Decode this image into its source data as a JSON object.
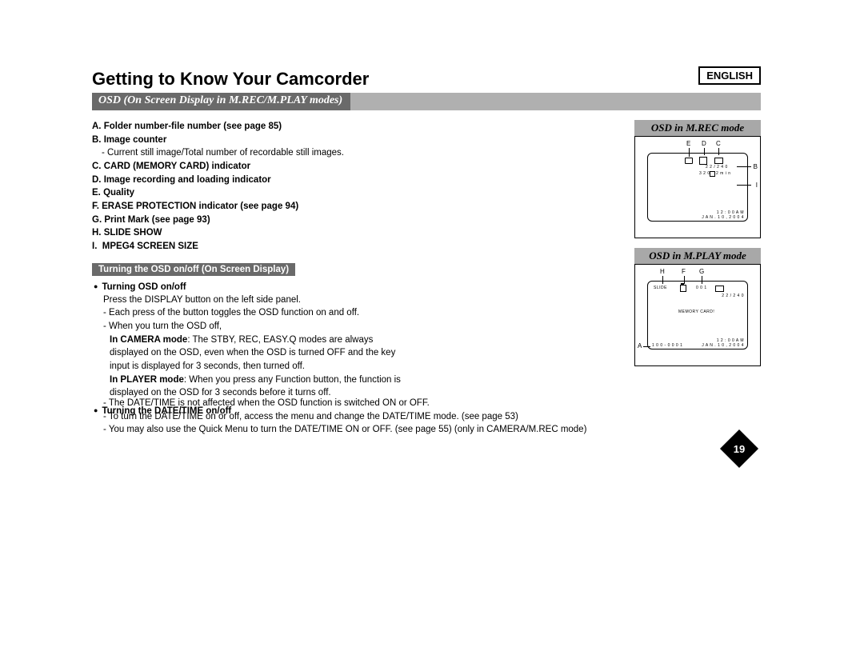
{
  "language_label": "ENGLISH",
  "page_title": "Getting to Know Your Camcorder",
  "banner": "OSD (On Screen Display in M.REC/M.PLAY modes)",
  "indicators": {
    "A": "Folder number-file number (see page 85)",
    "B": "Image counter",
    "B_sub": "Current still image/Total number of recordable still images.",
    "C": "CARD (MEMORY CARD) indicator",
    "D": "Image recording and loading indicator",
    "E": "Quality",
    "F": "ERASE PROTECTION indicator (see page 94)",
    "G": "Print Mark (see page 93)",
    "H": "SLIDE SHOW",
    "I": "MPEG4 SCREEN SIZE"
  },
  "section_bar": "Turning the OSD on/off (On Screen Display)",
  "bullet1_title": "Turning OSD on/off",
  "bullet1_body": "Press the DISPLAY button on the left side panel.",
  "bullet1_d1": "Each press of the button toggles the OSD function on and off.",
  "bullet1_d2": "When you turn the OSD off,",
  "bullet1_cam_lead": "In CAMERA mode",
  "bullet1_cam_text": ": The STBY, REC, EASY.Q modes are always displayed on the OSD, even when the OSD is turned OFF and the key input is displayed for 3 seconds, then turned off.",
  "bullet1_play_lead": "In PLAYER mode",
  "bullet1_play_text": ": When you press any Function button, the function is displayed on the OSD for 3 seconds before it turns off.",
  "bullet2_title": "Turning the DATE/TIME on/off",
  "bullet2_d1": "The DATE/TIME is not affected when the OSD function is switched ON or OFF.",
  "bullet2_d2": "To turn the DATE/TIME on or off, access the menu and change the DATE/TIME mode. (see page 53)",
  "bullet2_d3": "You may also use the Quick Menu to turn the DATE/TIME ON or OFF. (see page 55) (only in CAMERA/M.REC mode)",
  "diagram1_title": "OSD in M.REC mode",
  "diagram1": {
    "labels": {
      "E": "E",
      "D": "D",
      "C": "C",
      "B": "B",
      "I": "I"
    },
    "counter": "2 2 / 2 4 0",
    "size": "3 2 0",
    "size2": "2 m i n",
    "time": "1 2 : 0 0 A M",
    "date": "J A N .  1 0 ,  2 0 0 4"
  },
  "diagram2_title": "OSD in M.PLAY mode",
  "diagram2": {
    "labels": {
      "H": "H",
      "F": "F",
      "G": "G",
      "A": "A"
    },
    "slide": "SLIDE",
    "card": "MEMORY CARD!",
    "counter": "2 2 / 2 4 0",
    "pm": "0 0 1",
    "time": "1 2 : 0 0 A M",
    "date": "J A N .  1 0 ,  2 0 0 4",
    "file": "1 0 0 - 0 0 0 1"
  },
  "page_number": "19"
}
